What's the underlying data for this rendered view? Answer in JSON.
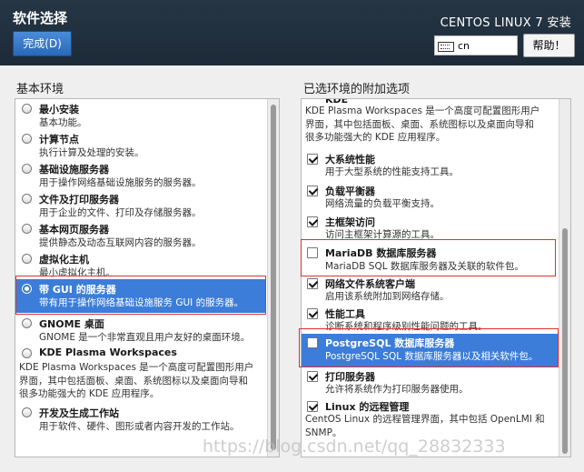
{
  "header": {
    "title": "软件选择",
    "done_label": "完成(D)",
    "product": "CENTOS LINUX 7 安装",
    "keyboard": "cn",
    "help_label": "帮助！"
  },
  "left": {
    "label": "基本环境",
    "items": [
      {
        "title": "最小安装",
        "desc": "基本功能。"
      },
      {
        "title": "计算节点",
        "desc": "执行计算及处理的安装。"
      },
      {
        "title": "基础设施服务器",
        "desc": "用于操作网络基础设施服务的服务器。"
      },
      {
        "title": "文件及打印服务器",
        "desc": "用于企业的文件、打印及存储服务器。"
      },
      {
        "title": "基本网页服务器",
        "desc": "提供静态及动态互联网内容的服务器。"
      },
      {
        "title": "虚拟化主机",
        "desc": "最小虚拟化主机。"
      },
      {
        "title": "带 GUI 的服务器",
        "desc": "带有用于操作网络基础设施服务 GUI 的服务器。"
      },
      {
        "title": "GNOME 桌面",
        "desc": "GNOME 是一个非常直观且用户友好的桌面环境。"
      },
      {
        "title": "KDE Plasma Workspaces",
        "desc": "KDE Plasma Workspaces 是一个高度可配置图形用户\n界面，其中包括面板、桌面、系统图标以及桌面向导和\n很多功能强大的 KDE 应用程序。"
      },
      {
        "title": "开发及生成工作站",
        "desc": "用于软件、硬件、图形或者内容开发的工作站。"
      }
    ]
  },
  "right": {
    "label": "已选环境的附加选项",
    "partial_title": "KDE",
    "partial_desc": "KDE Plasma Workspaces 是一个高度可配置图形用户\n界面，其中包括面板、桌面、系统图标以及桌面向导和\n很多功能强大的 KDE 应用程序。",
    "items": [
      {
        "title": "大系统性能",
        "desc": "用于大型系统的性能支持工具。"
      },
      {
        "title": "负载平衡器",
        "desc": "网络流量的负载平衡支持。"
      },
      {
        "title": "主框架访问",
        "desc": "访问主框架计算源的工具。"
      },
      {
        "title": "MariaDB 数据库服务器",
        "desc": "MariaDB SQL 数据库服务器及关联的软件包。"
      },
      {
        "title": "网络文件系统客户端",
        "desc": "启用该系统附加到网络存储。"
      },
      {
        "title": "性能工具",
        "desc": "诊断系统和程序级别性能问题的工具。"
      },
      {
        "title": "PostgreSQL 数据库服务器",
        "desc": "PostgreSQL SQL 数据库服务器以及相关软件包。"
      },
      {
        "title": "打印服务器",
        "desc": "允许将系统作为打印服务器使用。"
      },
      {
        "title": "Linux 的远程管理",
        "desc": "CentOS Linux 的远程管理界面，其中包括 OpenLMI 和\nSNMP。"
      }
    ]
  },
  "watermark": "https://blog.csdn.net/qq_28832333"
}
